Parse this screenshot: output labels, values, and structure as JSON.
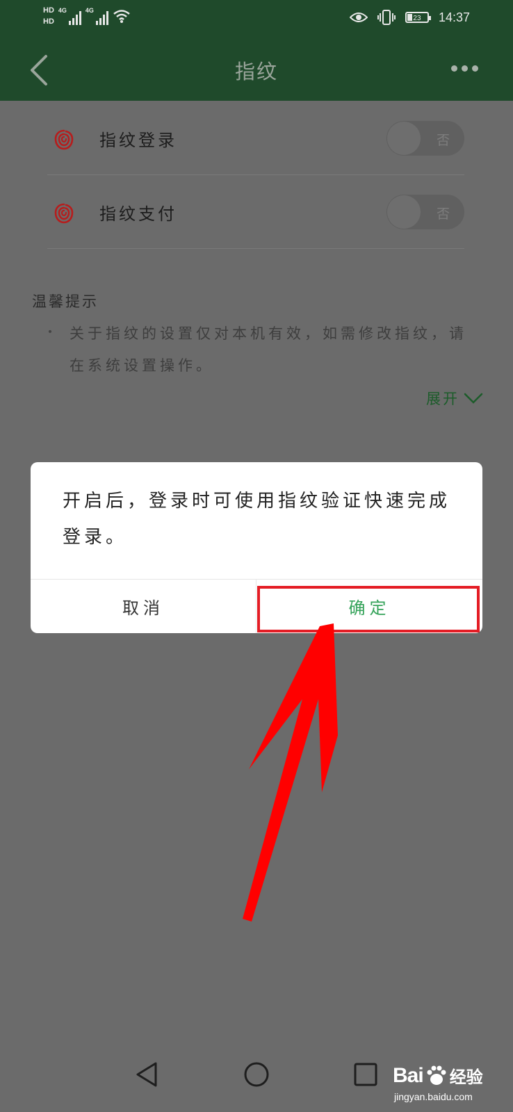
{
  "status_bar": {
    "hd1": "HD",
    "hd2": "HD",
    "sim1_label": "4G",
    "sim2_label": "4G",
    "battery": "23",
    "time": "14:37"
  },
  "nav": {
    "title": "指纹"
  },
  "settings": [
    {
      "label": "指纹登录",
      "state": "否"
    },
    {
      "label": "指纹支付",
      "state": "否"
    }
  ],
  "tips": {
    "title": "温馨提示",
    "body": "关于指纹的设置仅对本机有效，如需修改指纹，请在系统设置操作。",
    "expand": "展开"
  },
  "dialog": {
    "message": "开启后，登录时可使用指纹验证快速完成登录。",
    "cancel": "取消",
    "confirm": "确定"
  },
  "watermark": {
    "brand": "Bai",
    "suffix": "经验",
    "url": "jingyan.baidu.com"
  },
  "colors": {
    "header": "#1f4a2b",
    "overlay": "#6b6b6b",
    "confirm": "#35a35a",
    "highlight": "#e41d25",
    "fingerprint": "#c62828"
  }
}
